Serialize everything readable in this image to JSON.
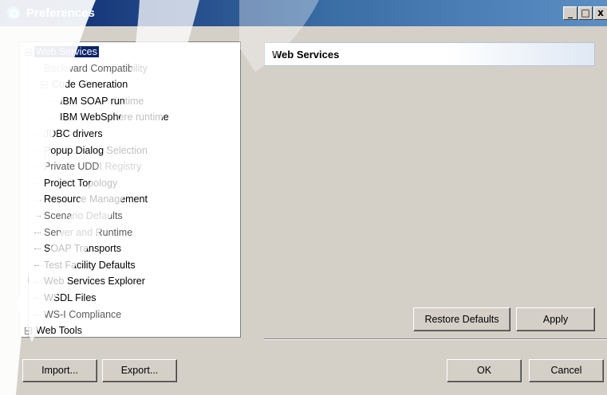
{
  "window": {
    "title": "Preferences",
    "controls": {
      "minimize": "_",
      "maximize": "□",
      "close": "x"
    }
  },
  "tree": {
    "items": [
      {
        "label": "Web Services",
        "level": 0,
        "expander": "minus",
        "selected": true,
        "gray": false
      },
      {
        "label": "Backward Compatibility",
        "level": 1,
        "gray": true
      },
      {
        "label": "Code Generation",
        "level": 1,
        "expander": "minus",
        "gray": false
      },
      {
        "label": "IBM SOAP runtime",
        "level": 2,
        "gray": false
      },
      {
        "label": "IBM WebSphere runtime",
        "level": 2,
        "gray": false
      },
      {
        "label": "JDBC drivers",
        "level": 1,
        "gray": false
      },
      {
        "label": "Popup Dialog Selection",
        "level": 1,
        "gray": false
      },
      {
        "label": "Private UDDI Registry",
        "level": 1,
        "gray": true
      },
      {
        "label": "Project Topology",
        "level": 1,
        "gray": false
      },
      {
        "label": "Resource Management",
        "level": 1,
        "gray": false
      },
      {
        "label": "Scenario Defaults",
        "level": 1,
        "gray": true
      },
      {
        "label": "Server and Runtime",
        "level": 1,
        "gray": true
      },
      {
        "label": "SOAP Transports",
        "level": 1,
        "gray": false
      },
      {
        "label": "Test Facility Defaults",
        "level": 1,
        "gray": false
      },
      {
        "label": "Web Services Explorer",
        "level": 1,
        "gray": false
      },
      {
        "label": "WSDL Files",
        "level": 1,
        "gray": false
      },
      {
        "label": "WS-I Compliance",
        "level": 1,
        "gray": true
      },
      {
        "label": "Web Tools",
        "level": 0,
        "expander": "plus",
        "gray": false
      }
    ]
  },
  "page": {
    "header": "Web Services",
    "restore_defaults": "Restore Defaults",
    "apply": "Apply"
  },
  "footer": {
    "import": "Import...",
    "export": "Export...",
    "ok": "OK",
    "cancel": "Cancel"
  },
  "colors": {
    "title_bar": "#0a246a",
    "selection": "#0a246a",
    "dialog_bg": "#d4d0c8"
  }
}
